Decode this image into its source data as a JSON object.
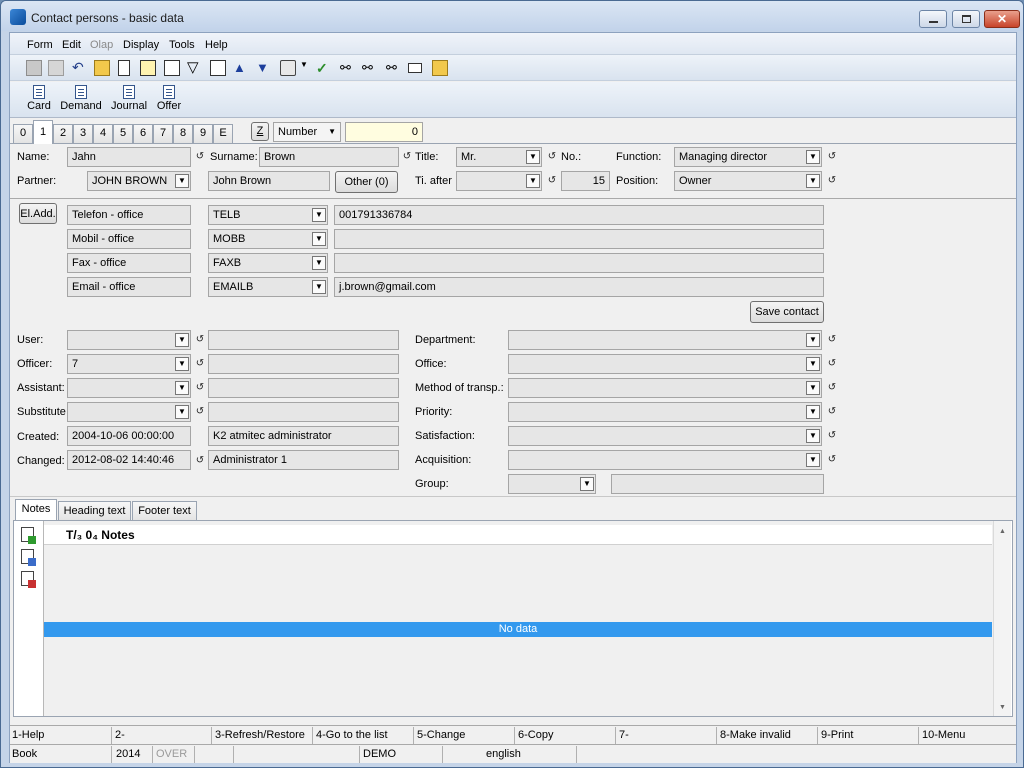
{
  "window": {
    "title": "Contact persons - basic data"
  },
  "menu": [
    "Form",
    "Edit",
    "Olap",
    "Display",
    "Tools",
    "Help"
  ],
  "toolbar2": [
    "Card",
    "Demand",
    "Journal",
    "Offer"
  ],
  "num_tabs": [
    "0",
    "1",
    "2",
    "3",
    "4",
    "5",
    "6",
    "7",
    "8",
    "9",
    "E"
  ],
  "sort": {
    "z_label": "Z",
    "field": "Number",
    "value": "0"
  },
  "contact": {
    "name_label": "Name:",
    "name": "Jahn",
    "surname_label": "Surname:",
    "surname": "Brown",
    "title_label": "Title:",
    "title": "Mr.",
    "no_label": "No.:",
    "function_label": "Function:",
    "function": "Managing director",
    "partner_label": "Partner:",
    "partner": "JOHN BROWN",
    "partner_name": "John Brown",
    "other_button": "Other (0)",
    "ti_after_label": "Ti. after",
    "ti_after": "",
    "ti_number": "15",
    "position_label": "Position:",
    "position": "Owner"
  },
  "el_add_button": "El.Add.",
  "connections": [
    {
      "type": "Telefon - office",
      "code": "TELB",
      "value": "001791336784"
    },
    {
      "type": "Mobil - office",
      "code": "MOBB",
      "value": ""
    },
    {
      "type": "Fax - office",
      "code": "FAXB",
      "value": ""
    },
    {
      "type": "Email - office",
      "code": "EMAILB",
      "value": "j.brown@gmail.com"
    }
  ],
  "save_contact_button": "Save contact",
  "left_fields": {
    "user_label": "User:",
    "user": "",
    "user_name": "",
    "officer_label": "Officer:",
    "officer": "7",
    "officer_name": "",
    "assistant_label": "Assistant:",
    "assistant": "",
    "assistant_name": "",
    "substitute_label": "Substitute",
    "substitute": "",
    "substitute_name": "",
    "created_label": "Created:",
    "created": "2004-10-06 00:00:00",
    "created_by": "K2 atmitec administrator",
    "changed_label": "Changed:",
    "changed": "2012-08-02 14:40:46",
    "changed_by": "Administrator 1"
  },
  "right_fields": {
    "department_label": "Department:",
    "department": "",
    "office_label": "Office:",
    "office": "",
    "transport_label": "Method of transp.:",
    "transport": "",
    "priority_label": "Priority:",
    "priority": "",
    "satisfaction_label": "Satisfaction:",
    "satisfaction": "",
    "acquisition_label": "Acquisition:",
    "acquisition": "",
    "group_label": "Group:",
    "group": "",
    "group_text": ""
  },
  "bottom_tabs": [
    "Notes",
    "Heading text",
    "Footer text"
  ],
  "notes": {
    "header": "Notes",
    "header_prefix": "T/₃ 0₄",
    "empty_text": "No data"
  },
  "fkeys": [
    "1-Help",
    "2-",
    "3-Refresh/Restore",
    "4-Go to the list",
    "5-Change",
    "6-Copy",
    "7-",
    "8-Make invalid",
    "9-Print",
    "10-Menu"
  ],
  "status": {
    "book": "Book",
    "year": "2014",
    "over": "OVER",
    "db": "DEMO",
    "language": "english"
  },
  "colors": {
    "accent": "#3399ee",
    "highlight_field": "#fffde0"
  }
}
